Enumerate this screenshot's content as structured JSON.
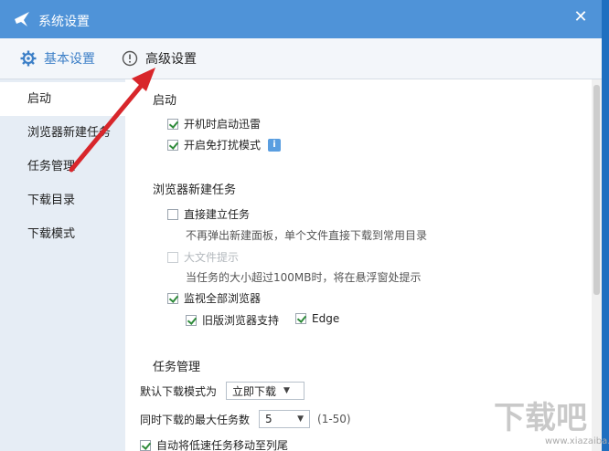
{
  "window": {
    "title": "系统设置",
    "close_glyph": "✕"
  },
  "tabs": {
    "basic": "基本设置",
    "advanced": "高级设置"
  },
  "sidebar": {
    "items": [
      {
        "label": "启动"
      },
      {
        "label": "浏览器新建任务"
      },
      {
        "label": "任务管理"
      },
      {
        "label": "下载目录"
      },
      {
        "label": "下载模式"
      }
    ]
  },
  "startup": {
    "title": "启动",
    "auto_start": "开机时启动迅雷",
    "no_disturb": "开启免打扰模式",
    "info_glyph": "i"
  },
  "browser": {
    "title": "浏览器新建任务",
    "direct_create": "直接建立任务",
    "direct_desc": "不再弹出新建面板，单个文件直接下载到常用目录",
    "big_file": "大文件提示",
    "big_file_desc": "当任务的大小超过100MB时，将在悬浮窗处提示",
    "monitor_all": "监视全部浏览器",
    "old_browser": "旧版浏览器支持",
    "edge": "Edge"
  },
  "task": {
    "title": "任务管理",
    "default_mode_label": "默认下载模式为",
    "default_mode_value": "立即下载",
    "max_tasks_label": "同时下载的最大任务数",
    "max_tasks_value": "5",
    "max_tasks_range": "(1-50)",
    "partial": "自动将低速任务移动至列尾"
  },
  "watermark": {
    "text": "下载吧",
    "sub": "www.xiazaiba.com"
  },
  "colors": {
    "titlebar": "#4f93d8",
    "accent": "#3c7fc7",
    "arrow": "#d8262b"
  }
}
